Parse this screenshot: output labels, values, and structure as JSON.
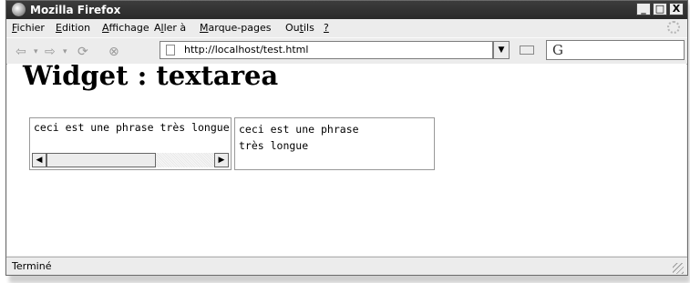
{
  "window": {
    "title": "Mozilla Firefox",
    "controls": [
      "_",
      "□",
      "X"
    ]
  },
  "menu": [
    {
      "pre": "",
      "u": "F",
      "post": "ichier"
    },
    {
      "pre": "",
      "u": "E",
      "post": "dition"
    },
    {
      "pre": "",
      "u": "A",
      "post": "ffichage"
    },
    {
      "pre": "A",
      "u": "l",
      "post": "ler à"
    },
    {
      "pre": "",
      "u": "M",
      "post": "arque-pages"
    },
    {
      "pre": "Ou",
      "u": "t",
      "post": "ils"
    },
    {
      "pre": "",
      "u": "?",
      "post": ""
    }
  ],
  "nav": {
    "url": "http://localhost/test.html",
    "search_glyph": "G"
  },
  "page": {
    "heading": "Widget : textarea",
    "textarea1": "ceci est une phrase très longue",
    "textarea2": "ceci est une phrase\ntrès longue"
  },
  "status": {
    "text": "Terminé"
  }
}
